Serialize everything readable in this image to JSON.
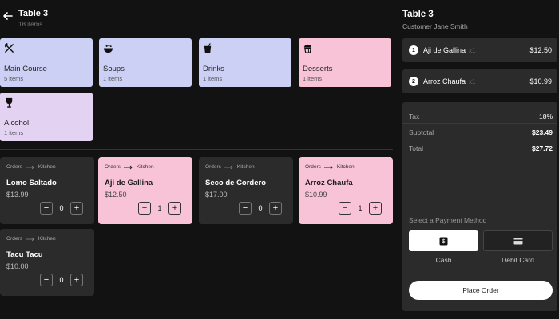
{
  "header": {
    "title": "Table 3",
    "subtitle": "18 items"
  },
  "categories": [
    {
      "name": "Main Course",
      "count": "5 items",
      "icon": "utensils-icon",
      "color": "#ccd0f5"
    },
    {
      "name": "Soups",
      "count": "1 items",
      "icon": "soup-bowl-icon",
      "color": "#ccd0f5"
    },
    {
      "name": "Drinks",
      "count": "1 items",
      "icon": "drink-icon",
      "color": "#ccd0f5"
    },
    {
      "name": "Desserts",
      "count": "1 items",
      "icon": "cupcake-icon",
      "color": "#f8c3d6"
    },
    {
      "name": "Alcohol",
      "count": "1 items",
      "icon": "wine-glass-icon",
      "color": "#e4d2f3"
    }
  ],
  "orders": [
    {
      "route_from": "Orders",
      "route_to": "Kitchen",
      "name": "Lomo Saltado",
      "price": "$13.99",
      "qty": "0",
      "selected": false
    },
    {
      "route_from": "Orders",
      "route_to": "Kitchen",
      "name": "Aji de Gallina",
      "price": "$12.50",
      "qty": "1",
      "selected": true
    },
    {
      "route_from": "Orders",
      "route_to": "Kitchen",
      "name": "Seco de Cordero",
      "price": "$17.00",
      "qty": "0",
      "selected": false
    },
    {
      "route_from": "Orders",
      "route_to": "Kitchen",
      "name": "Arroz Chaufa",
      "price": "$10.99",
      "qty": "1",
      "selected": true
    },
    {
      "route_from": "Orders",
      "route_to": "Kitchen",
      "name": "Tacu Tacu",
      "price": "$10.00",
      "qty": "0",
      "selected": false
    }
  ],
  "stepper": {
    "minus": "−",
    "plus": "+"
  },
  "panel": {
    "title": "Table 3",
    "customer": "Customer Jane Smith",
    "items": [
      {
        "num": "1",
        "name": "Aji de Gallina",
        "qty": "x1",
        "price": "$12.50"
      },
      {
        "num": "2",
        "name": "Arroz Chaufa",
        "qty": "x1",
        "price": "$10.99"
      }
    ],
    "tax_label": "Tax",
    "tax_value": "18%",
    "subtotal_label": "Subtotal",
    "subtotal_value": "$23.49",
    "total_label": "Total",
    "total_value": "$27.72",
    "payment_label": "Select a Payment Method",
    "cash_label": "Cash",
    "card_label": "Debit Card",
    "place_order": "Place Order"
  },
  "colors": {
    "accent_purple": "#ccd0f5",
    "accent_pink": "#f8c3d6",
    "accent_lavender": "#e4d2f3",
    "card_dark": "#2b2b2b"
  }
}
